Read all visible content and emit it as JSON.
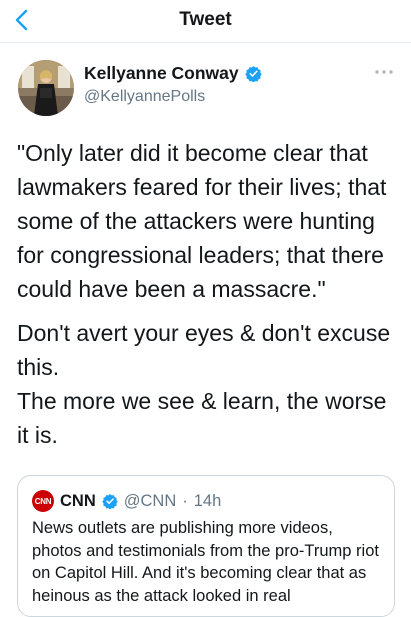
{
  "header": {
    "title": "Tweet",
    "back_icon": "chevron-left-icon"
  },
  "author": {
    "name": "Kellyanne Conway",
    "handle": "@KellyannePolls",
    "verified": true,
    "verified_color": "#1da1f2"
  },
  "tweet": {
    "paragraphs": [
      "\"Only later did it become clear that lawmakers feared for their lives; that some of the attackers were hunting for congressional leaders; that there could have been a massacre.\"",
      "Don't avert your eyes & don't excuse this.",
      "The more we see & learn, the worse it is."
    ]
  },
  "quote": {
    "logo_text": "CNN",
    "name": "CNN",
    "handle": "@CNN",
    "separator": "·",
    "time": "14h",
    "text": "News outlets are publishing more videos, photos and testimonials from the pro-Trump riot on Capitol Hill. And it's becoming clear that as heinous as the attack looked in real"
  },
  "colors": {
    "accent": "#1da1f2",
    "text": "#14171a",
    "muted": "#657786",
    "border": "#e6ecf0",
    "cnn_red": "#cc0000"
  }
}
